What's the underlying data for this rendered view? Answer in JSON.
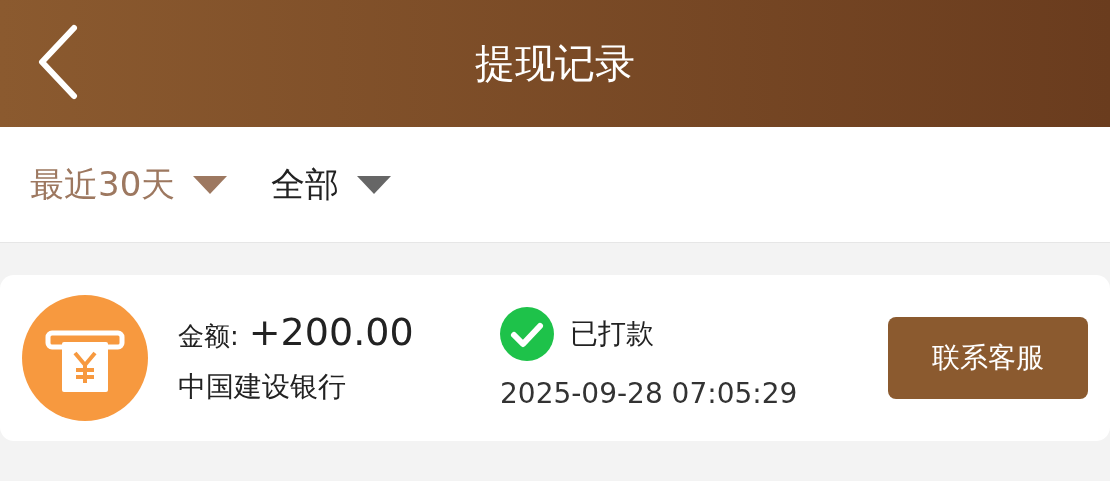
{
  "header": {
    "title": "提现记录"
  },
  "filters": [
    {
      "label": "最近30天",
      "selected": true
    },
    {
      "label": "全部",
      "selected": false
    }
  ],
  "records": [
    {
      "amount_label": "金额:",
      "amount": "+200.00",
      "bank": "中国建设银行",
      "status": "已打款",
      "paid": true,
      "time": "2025-09-28 07:05:29",
      "action": "联系客服"
    }
  ]
}
